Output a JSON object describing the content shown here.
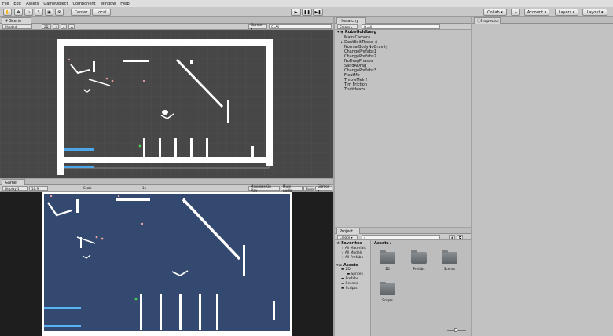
{
  "menu": [
    "File",
    "Edit",
    "Assets",
    "GameObject",
    "Component",
    "Window",
    "Help"
  ],
  "toolbar": {
    "pivot": "Center",
    "space": "Local",
    "collab": "Collab ▾",
    "account": "Account ▾",
    "layers": "Layers ▾",
    "layout": "Layout ▾"
  },
  "scene": {
    "tab": "# Scene",
    "shading": "Shaded",
    "mode_2d": "2D",
    "gizmos": "Gizmos ▾",
    "search": "Q▾All"
  },
  "game": {
    "tab": "Game",
    "display": "Display 1",
    "aspect": "16:9",
    "scale_label": "Scale",
    "scale_value": "1x",
    "maximize": "Maximize On Play",
    "mute": "Mute Audio",
    "stats": "Stats",
    "gizmos": "Gizmos ▾"
  },
  "hierarchy": {
    "tab": "Hierarchy",
    "create": "Create ▾",
    "search": "Q▾All",
    "scene": "RubeGoldberg",
    "items": [
      "Main Camera",
      "DontEditThese :)",
      "NormalBodyNoGravity",
      "ChangePrefabs1",
      "ChangePrefabs2",
      "NoDragPhases",
      "SandADrag",
      "ChangePrefabs3",
      "FloatMe",
      "ThrowMeIn!",
      "Tim Friction",
      "ThatHeave"
    ]
  },
  "inspector": {
    "tab": "Inspector"
  },
  "project": {
    "tab": "Project",
    "create": "Create ▾",
    "favorites": "Favorites",
    "fav_items": [
      "All Materials",
      "All Models",
      "All Prefabs"
    ],
    "assets": "Assets",
    "tree": [
      "2D",
      "Sprites",
      "Prefabs",
      "Scenes",
      "Scripts"
    ],
    "breadcrumb": "Assets ▸",
    "folders": [
      "2D",
      "Prefabs",
      "Scenes",
      "Scripts"
    ]
  }
}
